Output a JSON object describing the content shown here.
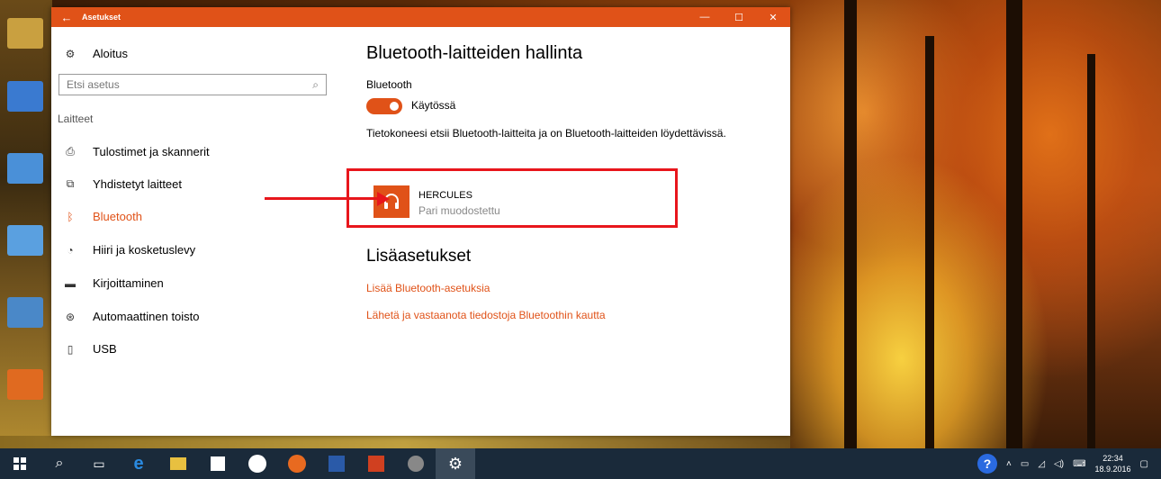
{
  "window": {
    "title": "Asetukset",
    "back_glyph": "←",
    "controls": {
      "minimize": "—",
      "maximize": "☐",
      "close": "✕"
    }
  },
  "sidebar": {
    "home_label": "Aloitus",
    "search_placeholder": "Etsi asetus",
    "category": "Laitteet",
    "items": [
      {
        "label": "Tulostimet ja skannerit",
        "icon": "printer-icon"
      },
      {
        "label": "Yhdistetyt laitteet",
        "icon": "connected-devices-icon"
      },
      {
        "label": "Bluetooth",
        "icon": "bluetooth-icon",
        "active": true
      },
      {
        "label": "Hiiri ja kosketuslevy",
        "icon": "mouse-icon"
      },
      {
        "label": "Kirjoittaminen",
        "icon": "keyboard-icon"
      },
      {
        "label": "Automaattinen toisto",
        "icon": "autoplay-icon"
      },
      {
        "label": "USB",
        "icon": "usb-icon"
      }
    ]
  },
  "main": {
    "title": "Bluetooth-laitteiden hallinta",
    "bluetooth_label": "Bluetooth",
    "toggle_state": "Käytössä",
    "description": "Tietokoneesi etsii Bluetooth-laitteita ja on Bluetooth-laitteiden löydettävissä.",
    "device": {
      "name": "HERCULES",
      "status": "Pari muodostettu",
      "icon": "headphones-icon"
    },
    "more_title": "Lisäasetukset",
    "links": [
      "Lisää Bluetooth-asetuksia",
      "Lähetä ja vastaanota tiedostoja Bluetoothin kautta"
    ]
  },
  "taskbar": {
    "clock_time": "22:34",
    "clock_date": "18.9.2016"
  },
  "colors": {
    "accent": "#e05218",
    "highlight": "#e8161c"
  }
}
